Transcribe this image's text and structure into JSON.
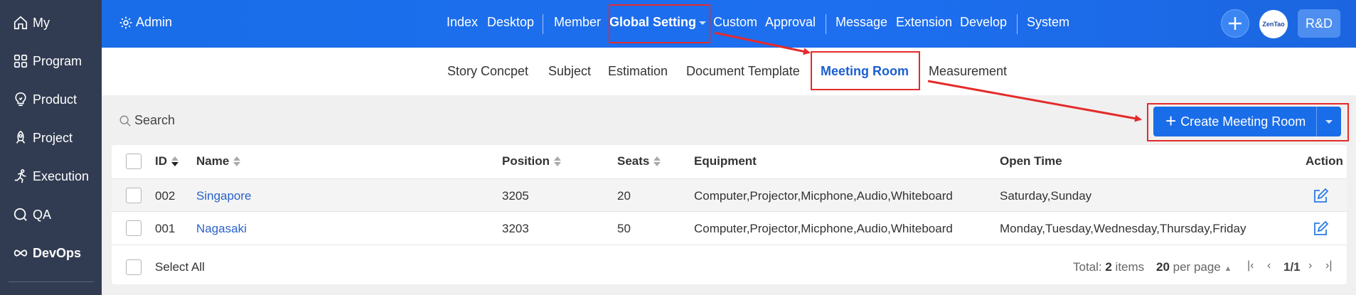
{
  "sidebar": {
    "items": [
      {
        "label": "My",
        "icon": "home-icon"
      },
      {
        "label": "Program",
        "icon": "grid-icon"
      },
      {
        "label": "Product",
        "icon": "lightbulb-icon"
      },
      {
        "label": "Project",
        "icon": "rocket-icon"
      },
      {
        "label": "Execution",
        "icon": "runner-icon"
      },
      {
        "label": "QA",
        "icon": "magnifier-icon"
      },
      {
        "label": "DevOps",
        "icon": "infinity-icon"
      }
    ]
  },
  "topbar": {
    "admin_label": "Admin",
    "nav": [
      "Index",
      "Desktop",
      "Member",
      "Global Setting",
      "Custom",
      "Approval",
      "Message",
      "Extension",
      "Develop",
      "System"
    ],
    "logo_text": "ZenTao",
    "user_label": "R&D"
  },
  "subnav": {
    "items": [
      "Story Concpet",
      "Subject",
      "Estimation",
      "Document Template",
      "Meeting Room",
      "Measurement"
    ]
  },
  "toolbar": {
    "search_label": "Search",
    "create_label": "Create Meeting Room"
  },
  "table": {
    "headers": {
      "id": "ID",
      "name": "Name",
      "position": "Position",
      "seats": "Seats",
      "equipment": "Equipment",
      "open_time": "Open Time",
      "action": "Action"
    },
    "rows": [
      {
        "id": "002",
        "name": "Singapore",
        "position": "3205",
        "seats": "20",
        "equipment": "Computer,Projector,Micphone,Audio,Whiteboard",
        "open_time": "Saturday,Sunday"
      },
      {
        "id": "001",
        "name": "Nagasaki",
        "position": "3203",
        "seats": "50",
        "equipment": "Computer,Projector,Micphone,Audio,Whiteboard",
        "open_time": "Monday,Tuesday,Wednesday,Thursday,Friday"
      }
    ],
    "select_all": "Select All",
    "pager": {
      "total_prefix": "Total: ",
      "total_count": "2",
      "total_suffix": " items",
      "per_page_count": "20",
      "per_page_suffix": " per page",
      "page": "1/1"
    }
  },
  "colors": {
    "topbar": "#1a6de8",
    "sidebar": "#313c52",
    "accent": "#1c5fd1",
    "highlight": "#e52a2a"
  }
}
